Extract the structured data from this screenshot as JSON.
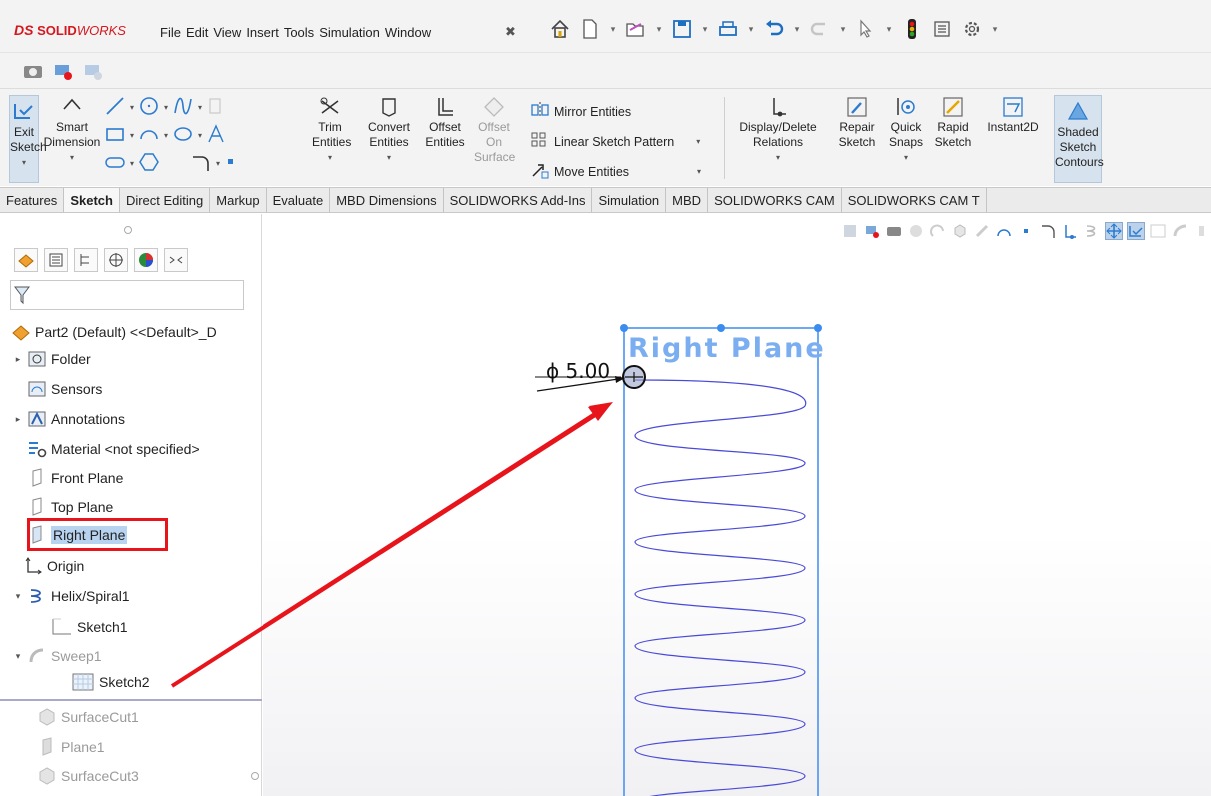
{
  "app": {
    "logo_ds": "DS",
    "logo_solid": "SOLID",
    "logo_works": "WORKS",
    "menu": [
      "File",
      "Edit",
      "View",
      "Insert",
      "Tools",
      "Simulation",
      "Window"
    ],
    "pin_icon": "pin-icon"
  },
  "quick_access": [
    "home-icon",
    "new-document-icon",
    "open-icon",
    "save-icon",
    "print-icon",
    "undo-icon",
    "redo-icon",
    "select-icon",
    "rebuild-traffic-light-icon",
    "file-properties-icon",
    "options-gear-icon"
  ],
  "command_manager": {
    "exit_sketch": [
      "Exit",
      "Sketch"
    ],
    "smart_dimension": [
      "Smart",
      "Dimension"
    ],
    "trim": [
      "Trim",
      "Entities"
    ],
    "convert": [
      "Convert",
      "Entities"
    ],
    "offset": [
      "Offset",
      "Entities"
    ],
    "offset_on_surface": [
      "Offset",
      "On",
      "Surface"
    ],
    "mirror": "Mirror Entities",
    "linear_pattern": "Linear Sketch Pattern",
    "move": "Move Entities",
    "display_delete": [
      "Display/Delete",
      "Relations"
    ],
    "repair": [
      "Repair",
      "Sketch"
    ],
    "quick_snaps": [
      "Quick",
      "Snaps"
    ],
    "rapid_sketch": [
      "Rapid",
      "Sketch"
    ],
    "instant2d": "Instant2D",
    "shaded_contours": [
      "Shaded",
      "Sketch",
      "Contours"
    ]
  },
  "tabs": [
    "Features",
    "Sketch",
    "Direct Editing",
    "Markup",
    "Evaluate",
    "MBD Dimensions",
    "SOLIDWORKS Add-Ins",
    "Simulation",
    "MBD",
    "SOLIDWORKS CAM",
    "SOLIDWORKS CAM T"
  ],
  "active_tab": "Sketch",
  "tree": {
    "root": "Part2 (Default) <<Default>_D",
    "items": [
      {
        "label": "Folder"
      },
      {
        "label": "Sensors"
      },
      {
        "label": "Annotations"
      },
      {
        "label": "Material <not specified>"
      },
      {
        "label": "Front Plane"
      },
      {
        "label": "Top Plane"
      },
      {
        "label": "Right Plane"
      },
      {
        "label": "Origin"
      },
      {
        "label": "Helix/Spiral1"
      },
      {
        "label": "Sketch1"
      },
      {
        "label": "Sweep1"
      },
      {
        "label": "Sketch2"
      },
      {
        "label": "SurfaceCut1"
      },
      {
        "label": "Plane1"
      },
      {
        "label": "SurfaceCut3"
      }
    ]
  },
  "graphics": {
    "plane_label": "Right Plane",
    "dimension": "ϕ 5.00",
    "annotation_color": "#e8141b",
    "helix_color": "#4a4ad8",
    "plane_color": "#3c8cf0"
  }
}
